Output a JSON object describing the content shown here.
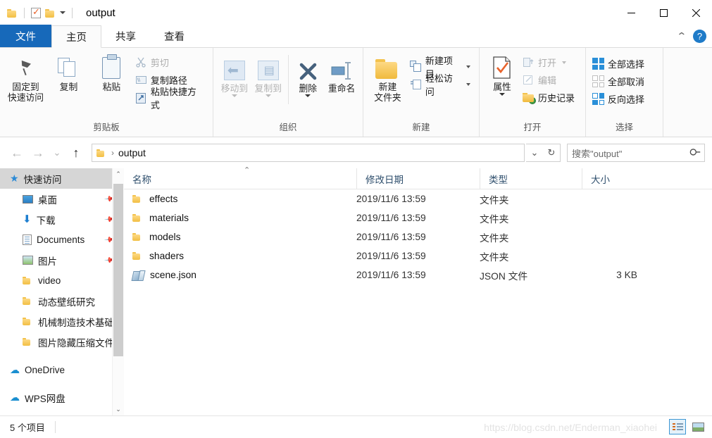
{
  "titlebar": {
    "quick_access": [
      {
        "name": "folder-icon",
        "label": ""
      },
      {
        "name": "properties-checkbox-icon",
        "label": ""
      },
      {
        "name": "new-folder-icon",
        "label": ""
      }
    ],
    "title": "output",
    "minimize": "—",
    "maximize": "□",
    "close": "✕"
  },
  "tabs": [
    {
      "label": "文件",
      "kind": "file"
    },
    {
      "label": "主页",
      "kind": "active"
    },
    {
      "label": "共享",
      "kind": "normal"
    },
    {
      "label": "查看",
      "kind": "normal"
    }
  ],
  "ribbon_right": {
    "collapse": "⌃",
    "help": "?"
  },
  "ribbon": {
    "groups": [
      {
        "label": "剪贴板",
        "big": [
          {
            "label": "固定到\n快速访问",
            "line1": "固定到",
            "line2": "快速访问",
            "icon": "pin-icon",
            "disabled": false
          },
          {
            "label": "复制",
            "line1": "复制",
            "line2": "",
            "icon": "copy-icon",
            "disabled": false
          },
          {
            "label": "粘贴",
            "line1": "粘贴",
            "line2": "",
            "icon": "paste-icon",
            "disabled": false
          }
        ],
        "small": [
          {
            "label": "剪切",
            "icon": "scissors-icon",
            "disabled": true
          },
          {
            "label": "复制路径",
            "icon": "copy-path-icon",
            "disabled": false
          },
          {
            "label": "粘贴快捷方式",
            "icon": "paste-shortcut-icon",
            "disabled": false
          }
        ]
      },
      {
        "label": "组织",
        "big": [
          {
            "line1": "移动到",
            "line2": "",
            "icon": "move-to-icon",
            "disabled": true,
            "dropdown": true
          },
          {
            "line1": "复制到",
            "line2": "",
            "icon": "copy-to-icon",
            "disabled": true,
            "dropdown": true
          },
          {
            "line1": "删除",
            "line2": "",
            "icon": "delete-icon",
            "disabled": false,
            "dropdown": true
          },
          {
            "line1": "重命名",
            "line2": "",
            "icon": "rename-icon",
            "disabled": false
          }
        ],
        "small": []
      },
      {
        "label": "新建",
        "big": [
          {
            "line1": "新建",
            "line2": "文件夹",
            "icon": "new-folder-icon",
            "disabled": false
          }
        ],
        "small": [
          {
            "label": "新建项目",
            "icon": "new-item-icon",
            "disabled": false,
            "dropdown": true
          },
          {
            "label": "轻松访问",
            "icon": "easy-access-icon",
            "disabled": false,
            "dropdown": true
          }
        ]
      },
      {
        "label": "打开",
        "big": [
          {
            "line1": "属性",
            "line2": "",
            "icon": "properties-icon",
            "disabled": false,
            "dropdown": true
          }
        ],
        "small": [
          {
            "label": "打开",
            "icon": "open-icon",
            "disabled": true,
            "dropdown": true
          },
          {
            "label": "编辑",
            "icon": "edit-icon",
            "disabled": true
          },
          {
            "label": "历史记录",
            "icon": "history-icon",
            "disabled": false
          }
        ]
      },
      {
        "label": "选择",
        "big": [],
        "small": [
          {
            "label": "全部选择",
            "icon": "select-all-icon",
            "disabled": false
          },
          {
            "label": "全部取消",
            "icon": "select-none-icon",
            "disabled": false
          },
          {
            "label": "反向选择",
            "icon": "invert-selection-icon",
            "disabled": false
          }
        ]
      }
    ]
  },
  "addressbar": {
    "back": "←",
    "forward": "→",
    "recent": "⌄",
    "up": "↑",
    "breadcrumb_folder_icon": "folder-icon",
    "breadcrumb_sep": "›",
    "breadcrumb": "output",
    "dropdown": "⌄",
    "refresh": "↻",
    "search_placeholder": "搜索\"output\"",
    "search_icon": "search-icon"
  },
  "sidebar": {
    "items": [
      {
        "label": "快速访问",
        "icon": "star-icon",
        "selected": true,
        "indent": false,
        "pinned": false
      },
      {
        "label": "桌面",
        "icon": "desktop-icon",
        "selected": false,
        "indent": true,
        "pinned": true
      },
      {
        "label": "下载",
        "icon": "downloads-icon",
        "selected": false,
        "indent": true,
        "pinned": true
      },
      {
        "label": "Documents",
        "icon": "documents-icon",
        "selected": false,
        "indent": true,
        "pinned": true
      },
      {
        "label": "图片",
        "icon": "pictures-icon",
        "selected": false,
        "indent": true,
        "pinned": true
      },
      {
        "label": "video",
        "icon": "folder-icon",
        "selected": false,
        "indent": true,
        "pinned": false
      },
      {
        "label": "动态壁纸研究",
        "icon": "folder-icon",
        "selected": false,
        "indent": true,
        "pinned": false
      },
      {
        "label": "机械制造技术基础",
        "icon": "folder-icon",
        "selected": false,
        "indent": true,
        "pinned": false
      },
      {
        "label": "图片隐藏压缩文件",
        "icon": "folder-icon",
        "selected": false,
        "indent": true,
        "pinned": false
      },
      {
        "label": "OneDrive",
        "icon": "onedrive-icon",
        "selected": false,
        "indent": false,
        "pinned": false
      },
      {
        "label": "WPS网盘",
        "icon": "wps-cloud-icon",
        "selected": false,
        "indent": false,
        "pinned": false
      }
    ],
    "scroll_up": "⌃",
    "scroll_down": "⌄"
  },
  "filelist": {
    "columns": [
      {
        "label": "名称",
        "key": "name"
      },
      {
        "label": "修改日期",
        "key": "date"
      },
      {
        "label": "类型",
        "key": "type"
      },
      {
        "label": "大小",
        "key": "size"
      }
    ],
    "sort_indicator": "⌃",
    "rows": [
      {
        "name": "effects",
        "date": "2019/11/6 13:59",
        "type": "文件夹",
        "size": "",
        "icon": "folder-icon"
      },
      {
        "name": "materials",
        "date": "2019/11/6 13:59",
        "type": "文件夹",
        "size": "",
        "icon": "folder-icon"
      },
      {
        "name": "models",
        "date": "2019/11/6 13:59",
        "type": "文件夹",
        "size": "",
        "icon": "folder-icon"
      },
      {
        "name": "shaders",
        "date": "2019/11/6 13:59",
        "type": "文件夹",
        "size": "",
        "icon": "folder-icon"
      },
      {
        "name": "scene.json",
        "date": "2019/11/6 13:59",
        "type": "JSON 文件",
        "size": "3 KB",
        "icon": "json-file-icon"
      }
    ]
  },
  "statusbar": {
    "item_count": "5 个项目",
    "watermark": "https://blog.csdn.net/Enderman_xiaohei",
    "views": [
      {
        "name": "details-view",
        "active": true
      },
      {
        "name": "large-icons-view",
        "active": false
      }
    ]
  },
  "colors": {
    "accent": "#1769ba",
    "folder": "#f3c24c",
    "selection": "#d6d6d6",
    "help_blue": "#1f7bc8"
  }
}
